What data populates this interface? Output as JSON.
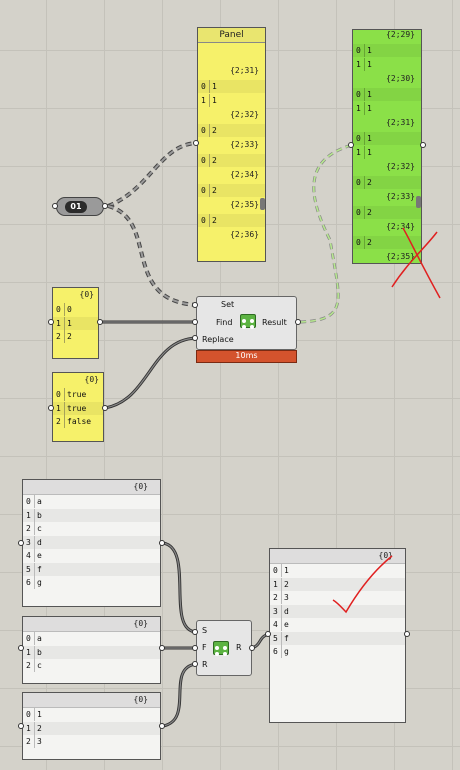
{
  "panel_top": {
    "title": "Panel",
    "groups": [
      {
        "branch": "{2;31}",
        "rows": [
          [
            "0",
            "1"
          ],
          [
            "1",
            "1"
          ]
        ]
      },
      {
        "branch": "{2;32}",
        "rows": [
          [
            "0",
            "2"
          ]
        ]
      },
      {
        "branch": "{2;33}",
        "rows": [
          [
            "0",
            "2"
          ]
        ]
      },
      {
        "branch": "{2;34}",
        "rows": [
          [
            "0",
            "2"
          ]
        ]
      },
      {
        "branch": "{2;35}",
        "rows": [
          [
            "0",
            "2"
          ]
        ]
      },
      {
        "branch": "{2;36}",
        "rows": []
      }
    ]
  },
  "panel_green": {
    "groups": [
      {
        "branch": "{2;29}",
        "rows": [
          [
            "0",
            "1"
          ],
          [
            "1",
            "1"
          ]
        ]
      },
      {
        "branch": "{2;30}",
        "rows": [
          [
            "0",
            "1"
          ],
          [
            "1",
            "1"
          ]
        ]
      },
      {
        "branch": "{2;31}",
        "rows": [
          [
            "0",
            "1"
          ],
          [
            "1",
            "1"
          ]
        ]
      },
      {
        "branch": "{2;32}",
        "rows": [
          [
            "0",
            "2"
          ]
        ]
      },
      {
        "branch": "{2;33}",
        "rows": [
          [
            "0",
            "2"
          ]
        ]
      },
      {
        "branch": "{2;34}",
        "rows": [
          [
            "0",
            "2"
          ]
        ]
      },
      {
        "branch": "{2;35}",
        "rows": []
      }
    ]
  },
  "toggle": {
    "label": "01"
  },
  "panel_find": {
    "branch": "{0}",
    "rows": [
      [
        "0",
        "0"
      ],
      [
        "1",
        "1"
      ],
      [
        "2",
        "2"
      ]
    ]
  },
  "panel_replace": {
    "branch": "{0}",
    "rows": [
      [
        "0",
        "true"
      ],
      [
        "1",
        "true"
      ],
      [
        "2",
        "false"
      ]
    ]
  },
  "component_top": {
    "set_label": "Set",
    "find_label": "Find",
    "replace_label": "Replace",
    "result_label": "Result",
    "time": "10ms"
  },
  "panel_s": {
    "branch": "{0}",
    "rows": [
      [
        "0",
        "a"
      ],
      [
        "1",
        "b"
      ],
      [
        "2",
        "c"
      ],
      [
        "3",
        "d"
      ],
      [
        "4",
        "e"
      ],
      [
        "5",
        "f"
      ],
      [
        "6",
        "g"
      ]
    ]
  },
  "panel_f": {
    "branch": "{0}",
    "rows": [
      [
        "0",
        "a"
      ],
      [
        "1",
        "b"
      ],
      [
        "2",
        "c"
      ]
    ]
  },
  "panel_r": {
    "branch": "{0}",
    "rows": [
      [
        "0",
        "1"
      ],
      [
        "1",
        "2"
      ],
      [
        "2",
        "3"
      ]
    ]
  },
  "component_bottom": {
    "s_label": "S",
    "f_label": "F",
    "r_label": "R",
    "out_label": "R"
  },
  "panel_result": {
    "branch": "{0}",
    "rows": [
      [
        "0",
        "1"
      ],
      [
        "1",
        "2"
      ],
      [
        "2",
        "3"
      ],
      [
        "3",
        "d"
      ],
      [
        "4",
        "e"
      ],
      [
        "5",
        "f"
      ],
      [
        "6",
        "g"
      ]
    ]
  },
  "annotations": {
    "cross_color": "#e02020",
    "check_color": "#e02020"
  }
}
